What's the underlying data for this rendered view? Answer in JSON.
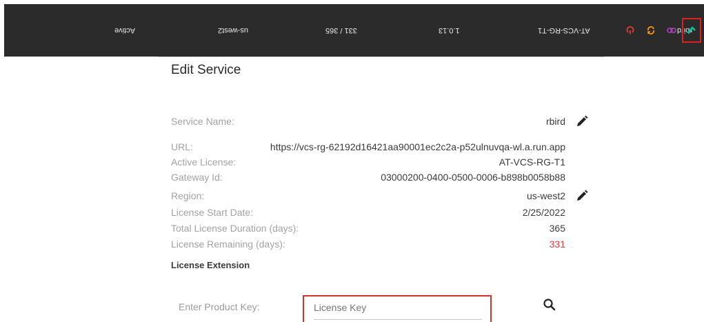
{
  "topbar": {
    "cells": [
      "rbird",
      "AT-VCS-RG-T1",
      "1.0.13",
      "331 / 365",
      "us-west2",
      "Active"
    ],
    "icons": [
      "power-icon",
      "refresh-icon",
      "link-icon",
      "check-icon"
    ],
    "colors": {
      "power": "#e53935",
      "refresh": "#ff9800",
      "link": "#ab47bc",
      "check": "#00c8a0"
    }
  },
  "dialog": {
    "title": "Edit Service",
    "fields": [
      {
        "label": "Service Name:",
        "value": "rbird"
      },
      {
        "label": "URL:",
        "value": "https://vcs-rg-62192d16421aa90001ec2c2a-p52ulnuvqa-wl.a.run.app"
      },
      {
        "label": "Active License:",
        "value": "AT-VCS-RG-T1"
      },
      {
        "label": "Gateway Id:",
        "value": "03000200-0400-0500-0006-b898b0058b88"
      },
      {
        "label": "Region:",
        "value": "us-west2"
      },
      {
        "label": "License Start Date:",
        "value": "2/25/2022"
      },
      {
        "label": "Total License Duration (days):",
        "value": "365"
      },
      {
        "label": "License Remaining (days):",
        "value": "331"
      }
    ],
    "section_title": "License Extension",
    "product_key_label": "Enter Product Key:",
    "product_key_placeholder": "License Key",
    "product_key_value": ""
  }
}
